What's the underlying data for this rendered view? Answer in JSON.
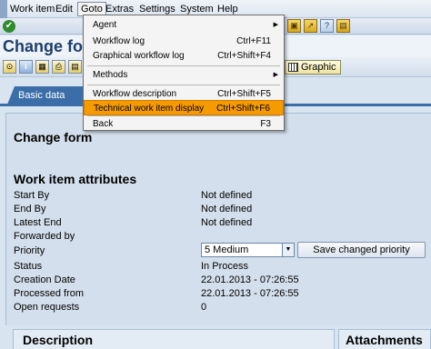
{
  "menubar": {
    "items": [
      "Work item",
      "Edit",
      "Goto",
      "Extras",
      "Settings",
      "System",
      "Help"
    ],
    "active_index": 2
  },
  "system_toolbar": {
    "icons": [
      "enter-icon",
      "create-session-icon",
      "generate-shortcut-icon",
      "help-icon",
      "customize-layout-icon"
    ]
  },
  "title": "Change form",
  "app_toolbar": {
    "icons": [
      "display-icon",
      "info-icon",
      "document-icon",
      "print-icon",
      "attachment-icon"
    ],
    "graphic_label": "Graphic"
  },
  "tabs": {
    "items": [
      "Basic data"
    ],
    "active_index": 0
  },
  "content": {
    "section_title": "Change form",
    "attributes_title": "Work item attributes",
    "rows": [
      {
        "label": "Start By",
        "value": "Not defined"
      },
      {
        "label": "End By",
        "value": "Not defined"
      },
      {
        "label": "Latest End",
        "value": "Not defined"
      },
      {
        "label": "Forwarded by",
        "value": ""
      },
      {
        "label": "Priority",
        "value": ""
      },
      {
        "label": "Status",
        "value": "In Process"
      },
      {
        "label": "Creation Date",
        "value": "22.01.2013 - 07:26:55"
      },
      {
        "label": "Processed from",
        "value": "22.01.2013 - 07:26:55"
      },
      {
        "label": "Open requests",
        "value": "0"
      }
    ],
    "priority_selected": "5 Medium",
    "save_priority_label": "Save changed priority",
    "description_title": "Description",
    "attachments_title": "Attachments"
  },
  "goto_menu": {
    "items": [
      {
        "label": "Agent",
        "shortcut": "",
        "submenu": true,
        "highlighted": false
      },
      {
        "label": "Workflow log",
        "shortcut": "Ctrl+F11",
        "submenu": false,
        "highlighted": false
      },
      {
        "label": "Graphical workflow log",
        "shortcut": "Ctrl+Shift+F4",
        "submenu": false,
        "highlighted": false
      },
      {
        "label": "Methods",
        "shortcut": "",
        "submenu": true,
        "highlighted": false
      },
      {
        "label": "Workflow description",
        "shortcut": "Ctrl+Shift+F5",
        "submenu": false,
        "highlighted": false
      },
      {
        "label": "Technical work item display",
        "shortcut": "Ctrl+Shift+F6",
        "submenu": false,
        "highlighted": true
      },
      {
        "label": "Back",
        "shortcut": "F3",
        "submenu": false,
        "highlighted": false
      }
    ]
  },
  "colors": {
    "highlight": "#f59a00",
    "title": "#1f3d6d",
    "tab": "#3b6ea8"
  }
}
